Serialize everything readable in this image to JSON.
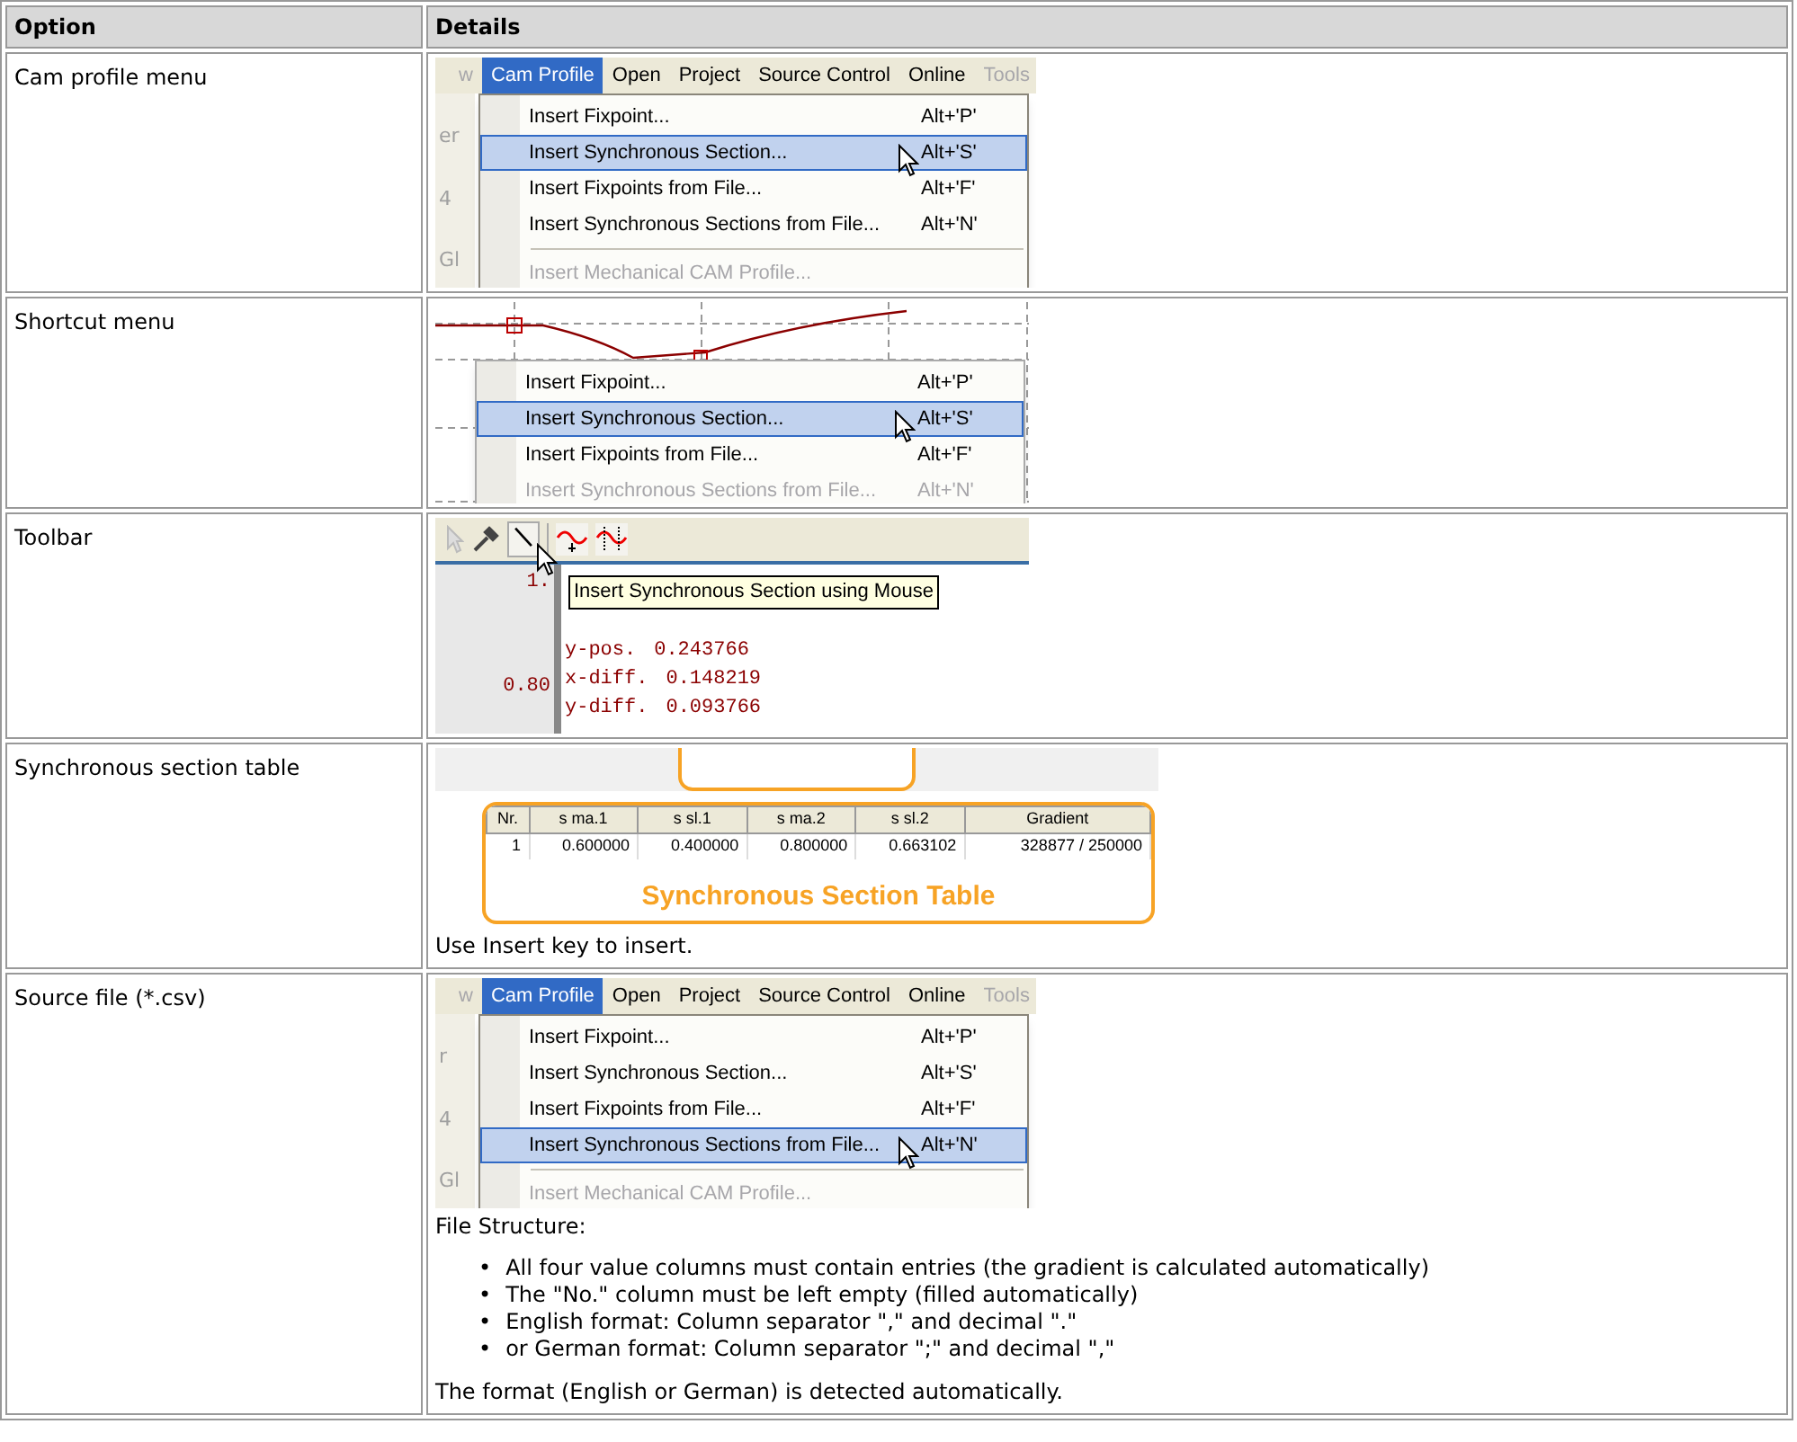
{
  "table": {
    "columns": [
      {
        "label": "Option"
      },
      {
        "label": "Details"
      }
    ],
    "rows": [
      {
        "option": "Cam profile menu",
        "details": [
          {
            "kind": "menu_screenshot",
            "side_texts": [
              "er",
              "4",
              "Gl"
            ],
            "menubar": [
              {
                "label": "w",
                "selected": false,
                "disabled": true
              },
              {
                "label": "Cam Profile",
                "selected": true,
                "disabled": false
              },
              {
                "label": "Open",
                "selected": false,
                "disabled": false
              },
              {
                "label": "Project",
                "selected": false,
                "disabled": false
              },
              {
                "label": "Source Control",
                "selected": false,
                "disabled": false
              },
              {
                "label": "Online",
                "selected": false,
                "disabled": false
              },
              {
                "label": "Tools",
                "selected": false,
                "disabled": true
              }
            ],
            "items": [
              {
                "kind": "item",
                "label": "Insert Fixpoint...",
                "shortcut": "Alt+'P'",
                "selected": false,
                "disabled": false
              },
              {
                "kind": "item",
                "label": "Insert Synchronous Section...",
                "shortcut": "Alt+'S'",
                "selected": true,
                "disabled": false
              },
              {
                "kind": "item",
                "label": "Insert Fixpoints from File...",
                "shortcut": "Alt+'F'",
                "selected": false,
                "disabled": false
              },
              {
                "kind": "item",
                "label": "Insert Synchronous Sections from File...",
                "shortcut": "Alt+'N'",
                "selected": false,
                "disabled": false
              },
              {
                "kind": "separator"
              },
              {
                "kind": "item",
                "label": "Insert Mechanical CAM Profile...",
                "selected": false,
                "disabled": true
              }
            ]
          }
        ]
      },
      {
        "option": "Shortcut menu",
        "details": [
          {
            "kind": "context_menu_screenshot",
            "items": [
              {
                "kind": "item",
                "label": "Insert Fixpoint...",
                "shortcut": "Alt+'P'",
                "selected": false,
                "disabled": false
              },
              {
                "kind": "item",
                "label": "Insert Synchronous Section...",
                "shortcut": "Alt+'S'",
                "selected": true,
                "disabled": false
              },
              {
                "kind": "item",
                "label": "Insert Fixpoints from File...",
                "shortcut": "Alt+'F'",
                "selected": false,
                "disabled": false
              },
              {
                "kind": "item",
                "label": "Insert Synchronous Sections from File...",
                "shortcut": "Alt+'N'",
                "selected": false,
                "disabled": true
              }
            ]
          }
        ]
      },
      {
        "option": "Toolbar",
        "details": [
          {
            "kind": "toolbar_screenshot",
            "tooltip": "Insert Synchronous Section using Mouse",
            "axis_labels": [
              "1.",
              "0.80"
            ],
            "readouts": [
              {
                "label": "y-pos.",
                "value": "0.243766"
              },
              {
                "label": "x-diff.",
                "value": "0.148219"
              },
              {
                "label": "y-diff.",
                "value": "0.093766"
              }
            ]
          }
        ]
      },
      {
        "option": "Synchronous section table",
        "details": [
          {
            "kind": "table_screenshot",
            "columns": [
              "Nr.",
              "s ma.1",
              "s sl.1",
              "s ma.2",
              "s sl.2",
              "Gradient"
            ],
            "rows": [
              [
                "1",
                "0.600000",
                "0.400000",
                "0.800000",
                "0.663102",
                "328877 / 250000"
              ]
            ],
            "caption": "Synchronous Section Table"
          },
          {
            "kind": "text",
            "text": "Use Insert key to insert."
          }
        ]
      },
      {
        "option": "Source file (*.csv)",
        "details": [
          {
            "kind": "menu_screenshot",
            "side_texts": [
              "r",
              "4",
              "Gl"
            ],
            "menubar": [
              {
                "label": "w",
                "selected": false,
                "disabled": true
              },
              {
                "label": "Cam Profile",
                "selected": true,
                "disabled": false
              },
              {
                "label": "Open",
                "selected": false,
                "disabled": false
              },
              {
                "label": "Project",
                "selected": false,
                "disabled": false
              },
              {
                "label": "Source Control",
                "selected": false,
                "disabled": false
              },
              {
                "label": "Online",
                "selected": false,
                "disabled": false
              },
              {
                "label": "Tools",
                "selected": false,
                "disabled": true
              }
            ],
            "items": [
              {
                "kind": "item",
                "label": "Insert Fixpoint...",
                "shortcut": "Alt+'P'",
                "selected": false,
                "disabled": false
              },
              {
                "kind": "item",
                "label": "Insert Synchronous Section...",
                "shortcut": "Alt+'S'",
                "selected": false,
                "disabled": false
              },
              {
                "kind": "item",
                "label": "Insert Fixpoints from File...",
                "shortcut": "Alt+'F'",
                "selected": false,
                "disabled": false
              },
              {
                "kind": "item",
                "label": "Insert Synchronous Sections from File...",
                "shortcut": "Alt+'N'",
                "selected": true,
                "disabled": false
              },
              {
                "kind": "separator"
              },
              {
                "kind": "item",
                "label": "Insert Mechanical CAM Profile...",
                "selected": false,
                "disabled": true
              }
            ]
          },
          {
            "kind": "text",
            "text": "File Structure:"
          },
          {
            "kind": "bullet_list",
            "items": [
              {
                "bullet": "•",
                "text": "All four value columns must contain entries (the gradient is calculated automatically)"
              },
              {
                "bullet": "•",
                "text": "The \"No.\" column must be left empty (filled automatically)"
              },
              {
                "bullet": "•",
                "text": "English format: Column separator \",\" and decimal \".\""
              },
              {
                "bullet": "•",
                "text": "or German format: Column separator \";\" and decimal \",\""
              }
            ]
          },
          {
            "kind": "text",
            "text": "The format (English or German) is detected automatically."
          }
        ]
      }
    ]
  }
}
